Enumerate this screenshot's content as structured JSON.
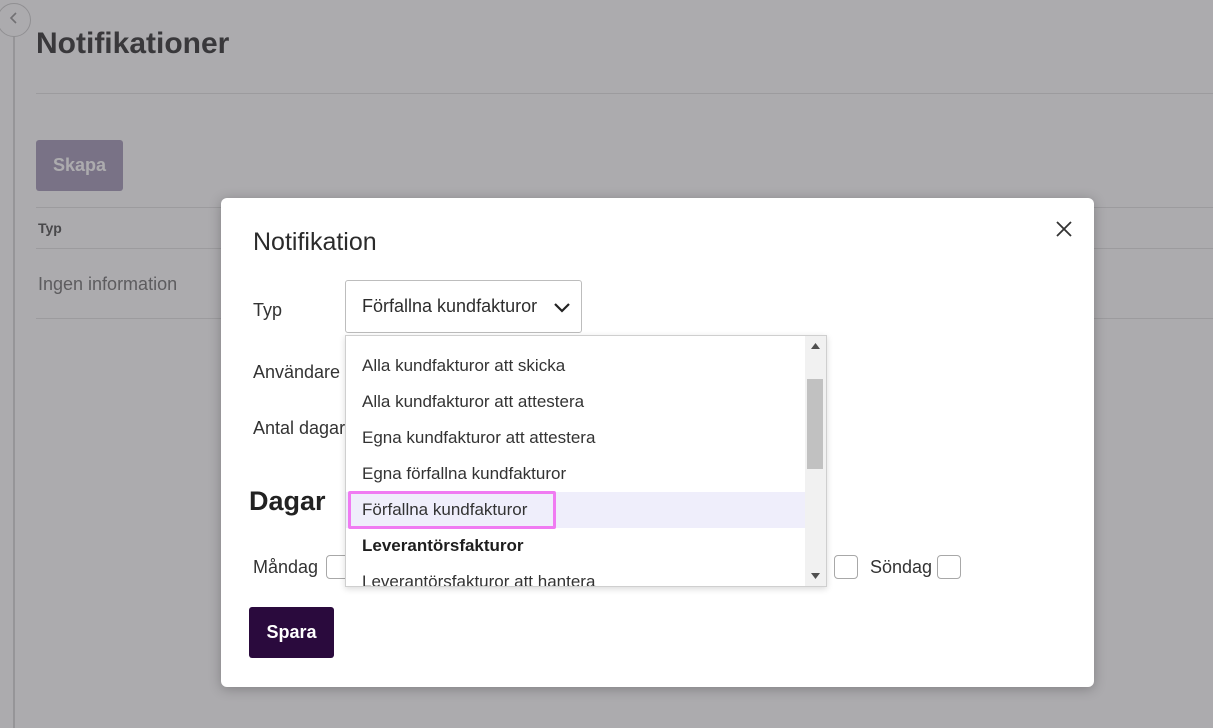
{
  "page": {
    "title": "Notifikationer",
    "create_button": "Skapa",
    "table_header_type": "Typ",
    "empty_text": "Ingen information"
  },
  "modal": {
    "title": "Notifikation",
    "type_label": "Typ",
    "type_value": "Förfallna kundfakturor",
    "user_label": "Användare",
    "days_count_label": "Antal dagar",
    "days_heading": "Dagar",
    "monday_label": "Måndag",
    "sunday_label": "Söndag",
    "save_button": "Spara"
  },
  "dropdown": {
    "options": [
      {
        "label": "Alla kundfakturor att skicka",
        "group": false
      },
      {
        "label": "Alla kundfakturor att attestera",
        "group": false
      },
      {
        "label": "Egna kundfakturor att attestera",
        "group": false
      },
      {
        "label": "Egna förfallna kundfakturor",
        "group": false
      },
      {
        "label": "Förfallna kundfakturor",
        "group": false,
        "selected": true
      },
      {
        "label": "Leverantörsfakturor",
        "group": true
      },
      {
        "label": "Leverantörsfakturor att hantera",
        "group": false
      }
    ]
  },
  "colors": {
    "primary": "#2a0a3d",
    "create_button_bg": "#a89ebb",
    "selected_option_bg": "#efeefb",
    "highlight_border": "#f07bf2"
  },
  "icons": [
    "chevron-left-icon",
    "close-icon",
    "chevron-down-icon",
    "scroll-up-arrow-icon",
    "scroll-down-arrow-icon"
  ]
}
